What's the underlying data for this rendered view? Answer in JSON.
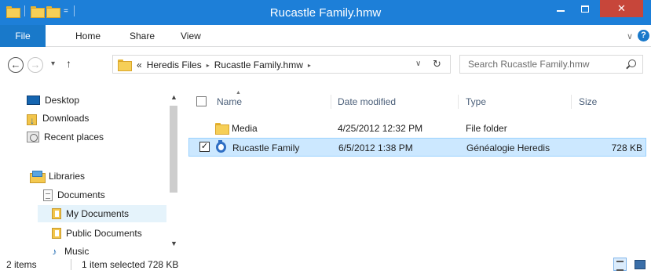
{
  "window": {
    "title": "Rucastle Family.hmw",
    "close_glyph": "✕",
    "qat_dropdown": "="
  },
  "ribbon": {
    "file": "File",
    "tabs": [
      "Home",
      "Share",
      "View"
    ],
    "collapse_glyph": "∨",
    "help_glyph": "?"
  },
  "navigation": {
    "back_glyph": "←",
    "forward_glyph": "→",
    "recent_glyph": "▾",
    "up_glyph": "↑",
    "breadcrumb_prefix": "«",
    "breadcrumb": [
      "Heredis Files",
      "Rucastle Family.hmw"
    ],
    "crumb_arrow": "▸",
    "address_dropdown": "∨",
    "refresh_glyph": "↻",
    "search_placeholder": "Search Rucastle Family.hmw"
  },
  "nav_pane": {
    "items": [
      {
        "label": "Desktop",
        "icon": "desktop-icon"
      },
      {
        "label": "Downloads",
        "icon": "downloads-icon"
      },
      {
        "label": "Recent places",
        "icon": "recent-places-icon"
      },
      {
        "label": "Libraries",
        "icon": "libraries-icon"
      },
      {
        "label": "Documents",
        "icon": "document-icon"
      },
      {
        "label": "My Documents",
        "icon": "my-documents-icon",
        "selected": true
      },
      {
        "label": "Public Documents",
        "icon": "folder-icon"
      },
      {
        "label": "Music",
        "icon": "music-icon"
      }
    ],
    "scroll_up_glyph": "▲",
    "scroll_down_glyph": "▼"
  },
  "file_list": {
    "columns": [
      "Name",
      "Date modified",
      "Type",
      "Size"
    ],
    "sort_glyph": "▲",
    "rows": [
      {
        "name": "Media",
        "date": "4/25/2012 12:32 PM",
        "type": "File folder",
        "size": "",
        "icon": "folder-icon",
        "selected": false
      },
      {
        "name": "Rucastle Family",
        "date": "6/5/2012 1:38 PM",
        "type": "Généalogie Heredis",
        "size": "728 KB",
        "icon": "heredis-file-icon",
        "selected": true
      }
    ]
  },
  "status": {
    "count": "2 items",
    "selection": "1 item selected  728 KB"
  },
  "colors": {
    "titlebar": "#1d7fd8",
    "file_tab": "#1979ca",
    "close_button": "#c7463a",
    "selection": "#cce8ff"
  }
}
